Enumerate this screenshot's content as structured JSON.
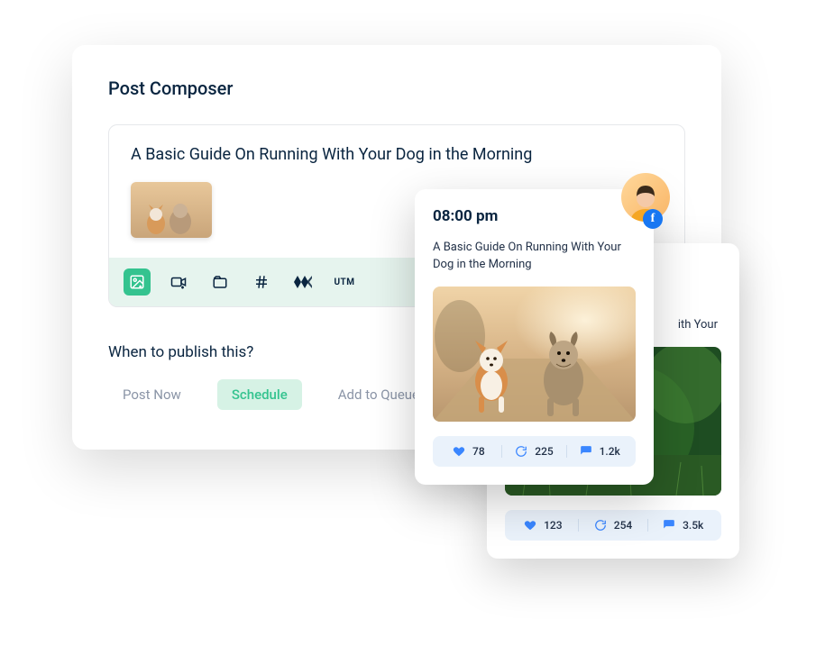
{
  "composer": {
    "page_title": "Post Composer",
    "post_title": "A Basic Guide On Running With Your Dog in the Morning",
    "toolbar": {
      "utm_label": "UTM"
    },
    "publish": {
      "label": "When to publish this?",
      "options": {
        "now": "Post Now",
        "schedule": "Schedule",
        "queue": "Add to Queue"
      }
    }
  },
  "previews": {
    "front": {
      "time": "08:00 pm",
      "title": "A Basic Guide On Running With Your Dog in the Morning",
      "stats": {
        "likes": "78",
        "shares": "225",
        "comments": "1.2k"
      }
    },
    "back": {
      "title_fragment": "ith Your",
      "stats": {
        "likes": "123",
        "shares": "254",
        "comments": "3.5k"
      }
    }
  }
}
